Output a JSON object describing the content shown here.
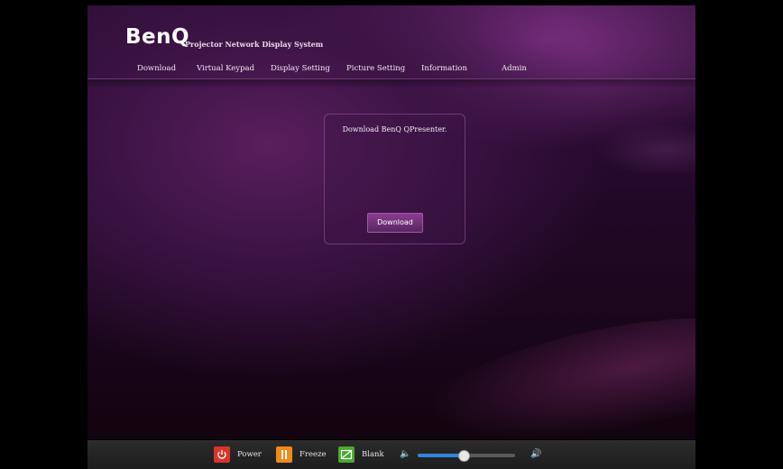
{
  "brand": {
    "logo": "BenQ",
    "title": "Projector Network Display System"
  },
  "nav": [
    {
      "label": "Download"
    },
    {
      "label": "Virtual Keypad"
    },
    {
      "label": "Display Setting"
    },
    {
      "label": "Picture Setting"
    },
    {
      "label": "Information"
    },
    {
      "label": "Admin"
    }
  ],
  "panel": {
    "message": "Download BenQ QPresenter.",
    "button_label": "Download"
  },
  "controls": {
    "power_label": "Power",
    "freeze_label": "Freeze",
    "blank_label": "Blank",
    "power_icon": "power-icon",
    "freeze_icon": "freeze-icon",
    "blank_icon": "blank-icon",
    "volume_level": 0.47
  },
  "colors": {
    "background": "#2b0d33",
    "accent": "#8a3d8f",
    "power": "#d8352a",
    "freeze": "#f08a1c",
    "blank": "#4aa832",
    "volume": "#2f86dc"
  }
}
